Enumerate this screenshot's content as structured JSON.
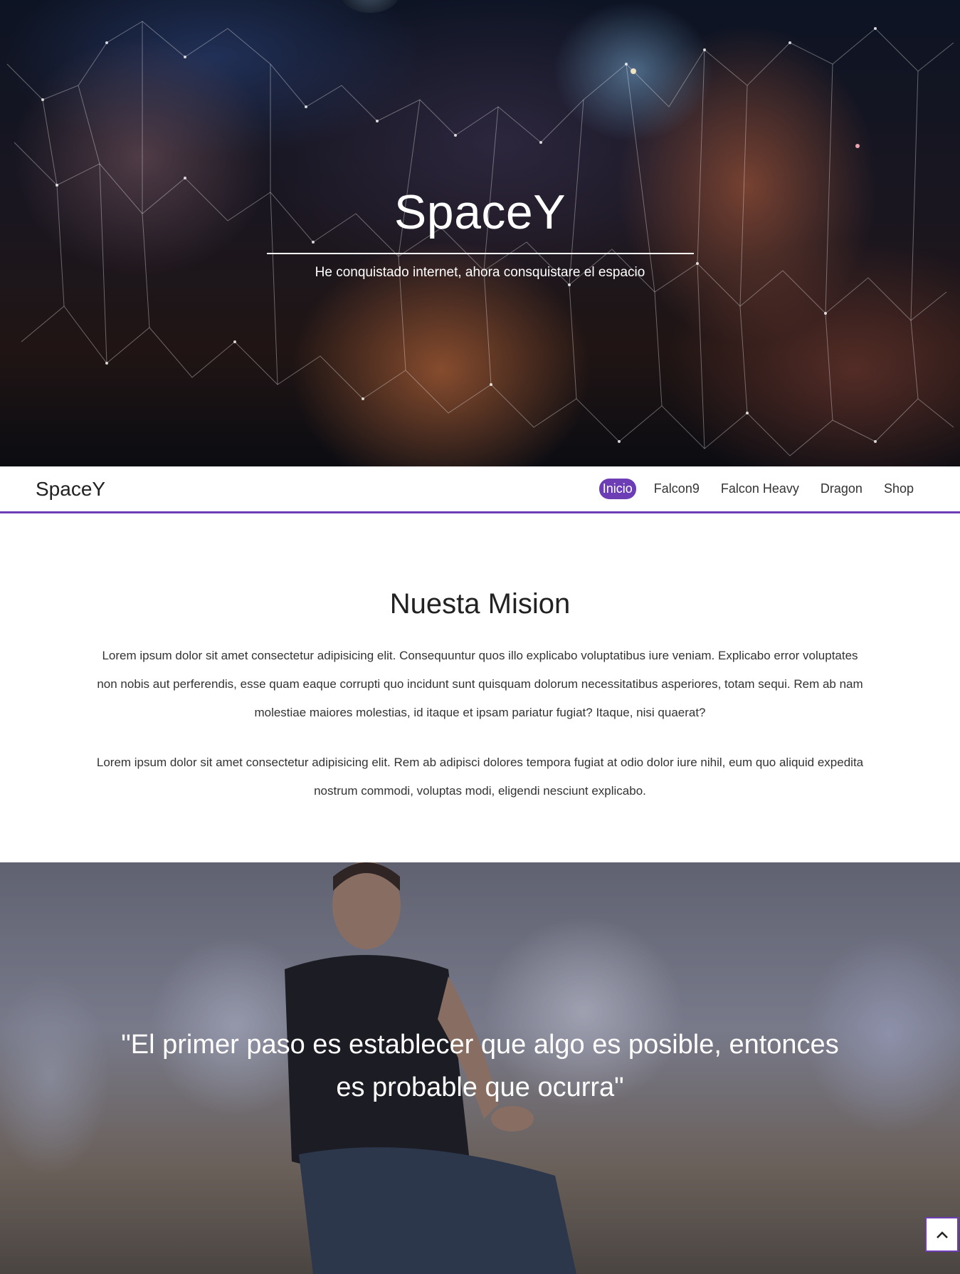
{
  "hero": {
    "title": "SpaceY",
    "subtitle": "He conquistado internet, ahora consquistare el espacio"
  },
  "navbar": {
    "brand": "SpaceY",
    "items": [
      {
        "label": "Inicio",
        "active": true
      },
      {
        "label": "Falcon9",
        "active": false
      },
      {
        "label": "Falcon Heavy",
        "active": false
      },
      {
        "label": "Dragon",
        "active": false
      },
      {
        "label": "Shop",
        "active": false
      }
    ]
  },
  "mission": {
    "title": "Nuesta Mision",
    "paragraphs": [
      "Lorem ipsum dolor sit amet consectetur adipisicing elit. Consequuntur quos illo explicabo voluptatibus iure veniam. Explicabo error voluptates non nobis aut perferendis, esse quam eaque corrupti quo incidunt sunt quisquam dolorum necessitatibus asperiores, totam sequi. Rem ab nam molestiae maiores molestias, id itaque et ipsam pariatur fugiat? Itaque, nisi quaerat?",
      "Lorem ipsum dolor sit amet consectetur adipisicing elit. Rem ab adipisci dolores tempora fugiat at odio dolor iure nihil, eum quo aliquid expedita nostrum commodi, voluptas modi, eligendi nesciunt explicabo."
    ]
  },
  "quote": {
    "text": "\"El primer paso es establecer que algo es posible, entonces es probable que ocurra\""
  },
  "scroll_top": {
    "icon": "chevron-up-icon"
  },
  "colors": {
    "accent": "#6c3db5"
  }
}
